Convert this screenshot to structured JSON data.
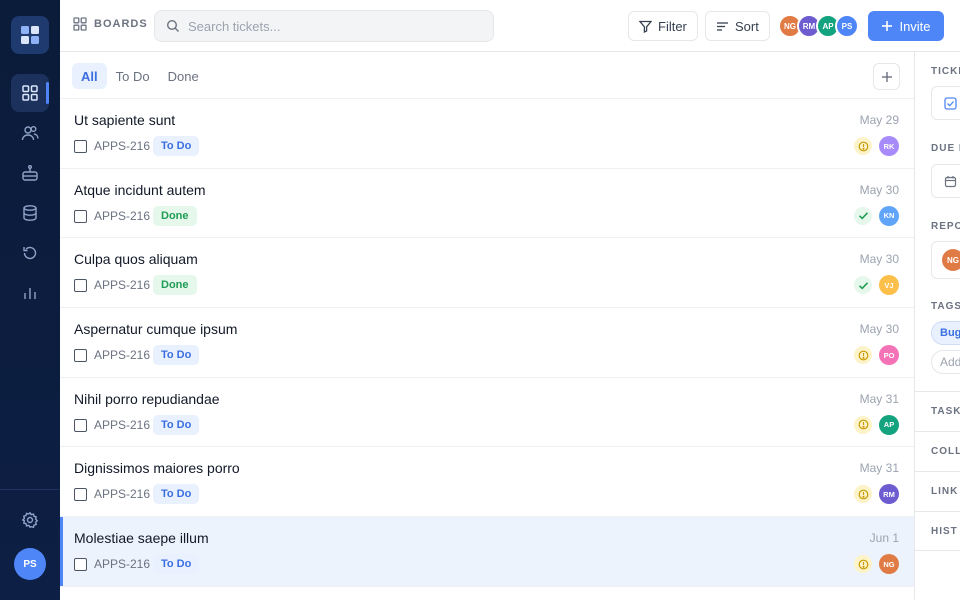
{
  "header": {
    "crumb_label": "BOARDS",
    "search_placeholder": "Search tickets...",
    "filter_label": "Filter",
    "sort_label": "Sort",
    "invite_label": "Invite",
    "members": [
      {
        "initials": "NG",
        "color": "#e07b45"
      },
      {
        "initials": "RM",
        "color": "#6d5bd0"
      },
      {
        "initials": "AP",
        "color": "#14a37f"
      },
      {
        "initials": "PS",
        "color": "#4f86f7"
      }
    ]
  },
  "sidebar": {
    "items": [
      {
        "icon": "grid-icon",
        "active": true
      },
      {
        "icon": "users-icon",
        "active": false
      },
      {
        "icon": "robot-icon",
        "active": false
      },
      {
        "icon": "database-icon",
        "active": false
      },
      {
        "icon": "history-icon",
        "active": false
      },
      {
        "icon": "chart-icon",
        "active": false
      }
    ],
    "settings_icon": "gear-icon",
    "user_initials": "PS"
  },
  "tabs": [
    {
      "label": "All",
      "active": true
    },
    {
      "label": "To Do",
      "active": false
    },
    {
      "label": "Done",
      "active": false
    }
  ],
  "tickets": [
    {
      "title": "Ut sapiente sunt",
      "key": "APPS-216",
      "status": "To Do",
      "status_kind": "todo",
      "date": "May 29",
      "state": "warn",
      "assignee": "RK",
      "assignee_color": "#a78bfa",
      "selected": false
    },
    {
      "title": "Atque incidunt autem",
      "key": "APPS-216",
      "status": "Done",
      "status_kind": "done",
      "date": "May 30",
      "state": "ok",
      "assignee": "KN",
      "assignee_color": "#60a5fa",
      "selected": false
    },
    {
      "title": "Culpa quos aliquam",
      "key": "APPS-216",
      "status": "Done",
      "status_kind": "done",
      "date": "May 30",
      "state": "ok",
      "assignee": "VJ",
      "assignee_color": "#fbbf4a",
      "selected": false
    },
    {
      "title": "Aspernatur cumque ipsum",
      "key": "APPS-216",
      "status": "To Do",
      "status_kind": "todo",
      "date": "May 30",
      "state": "warn",
      "assignee": "PO",
      "assignee_color": "#f472b6",
      "selected": false
    },
    {
      "title": "Nihil porro repudiandae",
      "key": "APPS-216",
      "status": "To Do",
      "status_kind": "todo",
      "date": "May 31",
      "state": "warn",
      "assignee": "AP",
      "assignee_color": "#14a37f",
      "selected": false
    },
    {
      "title": "Dignissimos maiores porro",
      "key": "APPS-216",
      "status": "To Do",
      "status_kind": "todo",
      "date": "May 31",
      "state": "warn",
      "assignee": "RM",
      "assignee_color": "#6d5bd0",
      "selected": false
    },
    {
      "title": "Molestiae saepe illum",
      "key": "APPS-216",
      "status": "To Do",
      "status_kind": "todo",
      "date": "Jun 1",
      "state": "warn",
      "assignee": "NG",
      "assignee_color": "#e07b45",
      "selected": true
    }
  ],
  "details": {
    "ticket_label": "TICKE",
    "due_label": "DUE D",
    "reporter_label": "REPO",
    "reporter_initials": "NG",
    "tags_label": "TAGS",
    "tag": "Bug",
    "add_tag": "Add",
    "sections": [
      "TASK",
      "COLL",
      "LINK",
      "HIST"
    ]
  }
}
